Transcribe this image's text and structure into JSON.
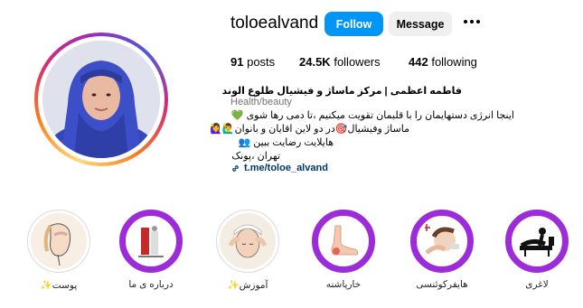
{
  "profile": {
    "username": "toloealvand",
    "follow_label": "Follow",
    "message_label": "Message",
    "more_icon": "more-horizontal-icon"
  },
  "stats": {
    "posts_count": "91",
    "posts_label": "posts",
    "followers_count": "24.5K",
    "followers_label": "followers",
    "following_count": "442",
    "following_label": "following"
  },
  "bio": {
    "name": "فاطمه اعظمی | مرکز ماساژ و فیشیال طلوع الوند",
    "category": "Health/beauty",
    "line1": "اینجا انرژی دستهایمان را با قلبمان تقویت میکنیم ،تا دمی رها شوی",
    "line1_emoji": "💚",
    "line2": "ماساژ وفیشیال🎯در دو لاین اقایان و بانوان🙋‍♂️🙋‍♀️",
    "line3": "هایلایت رضایت ببین",
    "line3_emoji": "👥",
    "line4": "تهران ،پونک",
    "link": "t.me/toloe_alvand"
  },
  "highlights": [
    {
      "label": "پوست✨"
    },
    {
      "label": "درباره ی ما"
    },
    {
      "label": "آموزش✨"
    },
    {
      "label": "خارپاشنه"
    },
    {
      "label": "هایفرکوئنسی"
    },
    {
      "label": "لاغری"
    }
  ],
  "colors": {
    "follow_bg": "#0095f6",
    "message_bg": "#efefef",
    "highlight_ring": "#9c2bd9",
    "link": "#00376b"
  }
}
